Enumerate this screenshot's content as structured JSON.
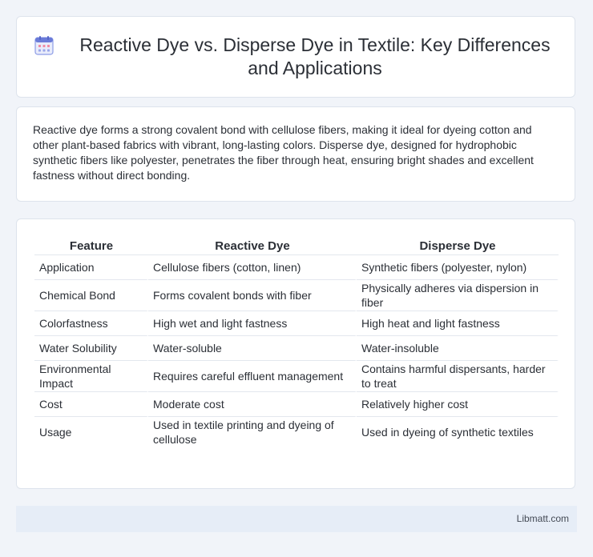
{
  "header": {
    "title": "Reactive Dye vs. Disperse Dye in Textile: Key Differences and Applications",
    "icon": "calendar-icon"
  },
  "intro": {
    "text": "Reactive dye forms a strong covalent bond with cellulose fibers, making it ideal for dyeing cotton and other plant-based fabrics with vibrant, long-lasting colors. Disperse dye, designed for hydrophobic synthetic fibers like polyester, penetrates the fiber through heat, ensuring bright shades and excellent fastness without direct bonding."
  },
  "table": {
    "headers": [
      "Feature",
      "Reactive Dye",
      "Disperse Dye"
    ],
    "rows": [
      [
        "Application",
        "Cellulose fibers (cotton, linen)",
        "Synthetic fibers (polyester, nylon)"
      ],
      [
        "Chemical Bond",
        "Forms covalent bonds with fiber",
        "Physically adheres via dispersion in fiber"
      ],
      [
        "Colorfastness",
        "High wet and light fastness",
        "High heat and light fastness"
      ],
      [
        "Water Solubility",
        "Water-soluble",
        "Water-insoluble"
      ],
      [
        "Environmental Impact",
        "Requires careful effluent management",
        "Contains harmful dispersants, harder to treat"
      ],
      [
        "Cost",
        "Moderate cost",
        "Relatively higher cost"
      ],
      [
        "Usage",
        "Used in textile printing and dyeing of cellulose",
        "Used in dyeing of synthetic textiles"
      ]
    ]
  },
  "footer": {
    "brand": "Libmatt.com"
  },
  "colors": {
    "background": "#f1f4f9",
    "card": "#ffffff",
    "footer": "#e6edf7",
    "icon_accent": "#6a7bd8"
  }
}
